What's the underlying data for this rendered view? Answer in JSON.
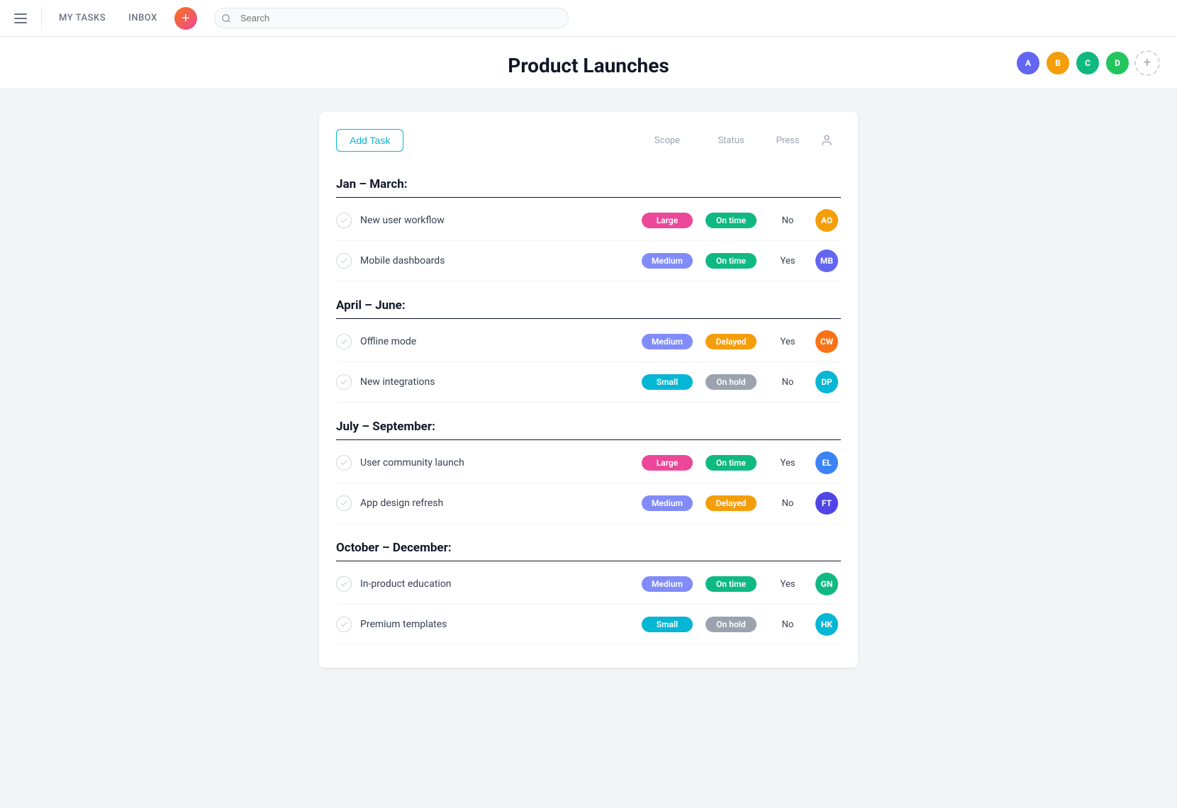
{
  "topbar": {
    "nav_items": [
      "MY TASKS",
      "INBOX"
    ],
    "search_placeholder": "Search"
  },
  "header": {
    "title": "Product Launches"
  },
  "toolbar": {
    "add_task_label": "Add Task",
    "col_scope": "Scope",
    "col_status": "Status",
    "col_press": "Press"
  },
  "sections": [
    {
      "title": "Jan – March:",
      "tasks": [
        {
          "name": "New user workflow",
          "scope": "Large",
          "scope_class": "badge-large",
          "status": "On time",
          "status_class": "badge-ontime",
          "press": "No",
          "avatar_color": "#f59e0b",
          "avatar_initials": "AO"
        },
        {
          "name": "Mobile dashboards",
          "scope": "Medium",
          "scope_class": "badge-medium",
          "status": "On time",
          "status_class": "badge-ontime",
          "press": "Yes",
          "avatar_color": "#6366f1",
          "avatar_initials": "MB"
        }
      ]
    },
    {
      "title": "April – June:",
      "tasks": [
        {
          "name": "Offline mode",
          "scope": "Medium",
          "scope_class": "badge-medium",
          "status": "Delayed",
          "status_class": "badge-delayed",
          "press": "Yes",
          "avatar_color": "#f97316",
          "avatar_initials": "CW"
        },
        {
          "name": "New integrations",
          "scope": "Small",
          "scope_class": "badge-small",
          "status": "On hold",
          "status_class": "badge-onhold",
          "press": "No",
          "avatar_color": "#06b6d4",
          "avatar_initials": "DP"
        }
      ]
    },
    {
      "title": "July – September:",
      "tasks": [
        {
          "name": "User community launch",
          "scope": "Large",
          "scope_class": "badge-large",
          "status": "On time",
          "status_class": "badge-ontime",
          "press": "Yes",
          "avatar_color": "#3b82f6",
          "avatar_initials": "EL"
        },
        {
          "name": "App design refresh",
          "scope": "Medium",
          "scope_class": "badge-medium",
          "status": "Delayed",
          "status_class": "badge-delayed",
          "press": "No",
          "avatar_color": "#4f46e5",
          "avatar_initials": "FT"
        }
      ]
    },
    {
      "title": "October – December:",
      "tasks": [
        {
          "name": "In-product education",
          "scope": "Medium",
          "scope_class": "badge-medium",
          "status": "On time",
          "status_class": "badge-ontime",
          "press": "Yes",
          "avatar_color": "#10b981",
          "avatar_initials": "GN"
        },
        {
          "name": "Premium templates",
          "scope": "Small",
          "scope_class": "badge-small",
          "status": "On hold",
          "status_class": "badge-onhold",
          "press": "No",
          "avatar_color": "#06b6d4",
          "avatar_initials": "HK"
        }
      ]
    }
  ],
  "avatars": [
    {
      "color": "#6366f1",
      "initials": "A"
    },
    {
      "color": "#f59e0b",
      "initials": "B"
    },
    {
      "color": "#10b981",
      "initials": "C"
    },
    {
      "color": "#22c55e",
      "initials": "D"
    }
  ]
}
